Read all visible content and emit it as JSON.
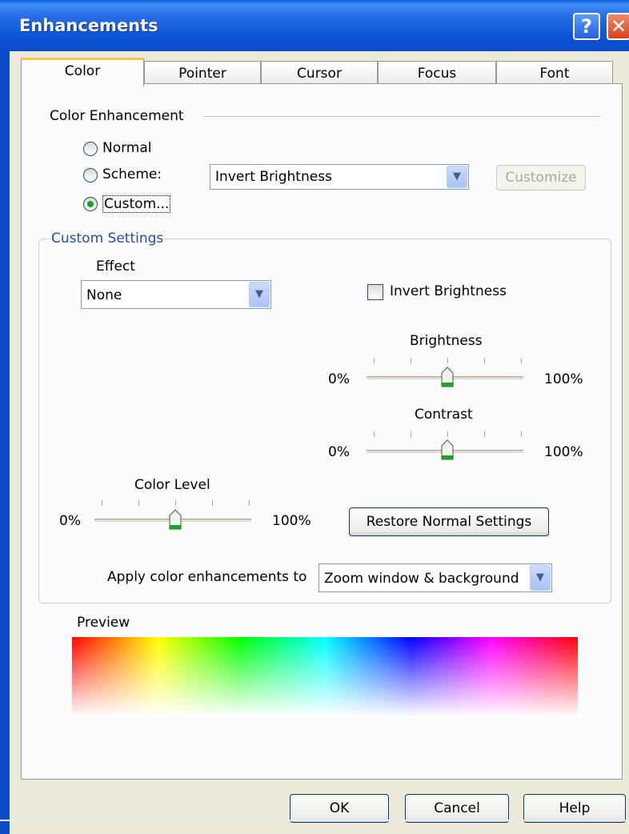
{
  "window": {
    "title": "Enhancements",
    "help_label": "?",
    "close_label": "✕"
  },
  "tabs": [
    {
      "label": "Color",
      "active": true
    },
    {
      "label": "Pointer",
      "active": false
    },
    {
      "label": "Cursor",
      "active": false
    },
    {
      "label": "Focus",
      "active": false
    },
    {
      "label": "Font",
      "active": false
    }
  ],
  "color_enhancement": {
    "heading": "Color Enhancement",
    "radio_normal": "Normal",
    "radio_scheme": "Scheme:",
    "radio_custom": "Custom...",
    "selected": "Custom...",
    "scheme_value": "Invert Brightness",
    "customize_button": "Customize"
  },
  "custom_settings": {
    "heading": "Custom Settings",
    "effect_label": "Effect",
    "effect_value": "None",
    "invert_brightness_label": "Invert Brightness",
    "invert_brightness_checked": false,
    "brightness": {
      "label": "Brightness",
      "min": "0%",
      "max": "100%",
      "value_percent": 50
    },
    "contrast": {
      "label": "Contrast",
      "min": "0%",
      "max": "100%",
      "value_percent": 50
    },
    "color_level": {
      "label": "Color Level",
      "min": "0%",
      "max": "100%",
      "value_percent": 50
    },
    "restore_button": "Restore Normal Settings",
    "apply_label": "Apply color enhancements to",
    "apply_value": "Zoom window & background"
  },
  "preview": {
    "label": "Preview"
  },
  "footer": {
    "ok": "OK",
    "cancel": "Cancel",
    "help": "Help"
  },
  "colors": {
    "titlebar": "#0a54d6",
    "accent_tab": "#ffc73c",
    "group_title": "#1f4fb0",
    "radio_dot": "#21a121"
  }
}
